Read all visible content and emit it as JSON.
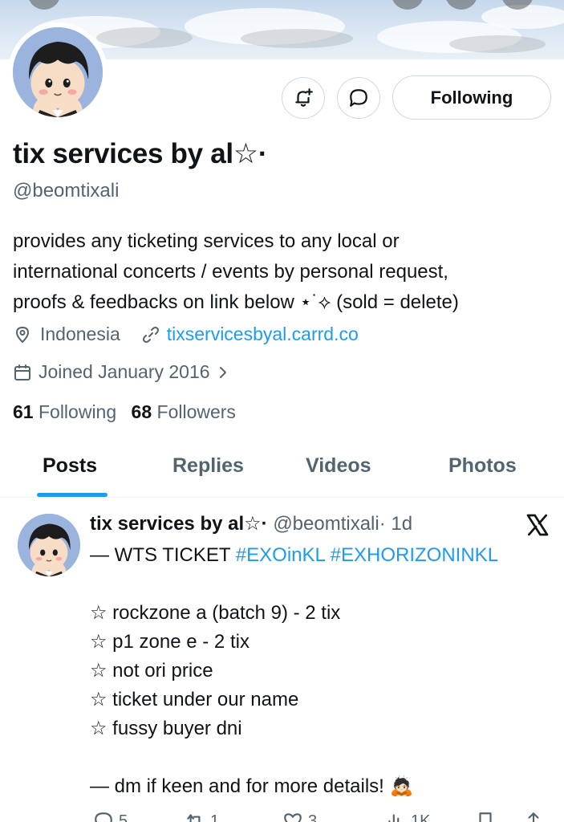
{
  "profile": {
    "display_name": "tix services by al☆·",
    "handle": "@beomtixali",
    "bio_lines": [
      "provides any ticketing services to any local or",
      "international concerts / events by personal request,",
      "proofs & feedbacks on link below ⋆˙⟡ (sold = delete)"
    ],
    "location": "Indonesia",
    "website": "tixservicesbyal.carrd.co",
    "joined": "Joined January 2016",
    "following_count": "61",
    "following_label": "Following",
    "followers_count": "68",
    "followers_label": "Followers",
    "follow_button_label": "Following"
  },
  "tabs": [
    {
      "label": "Posts",
      "active": true
    },
    {
      "label": "Replies",
      "active": false
    },
    {
      "label": "Videos",
      "active": false
    },
    {
      "label": "Photos",
      "active": false
    }
  ],
  "tweet": {
    "name": "tix services by al☆·",
    "handle": "@beomtixali",
    "time": "· 1d",
    "intro": "— WTS TICKET ",
    "hashtags": [
      "#EXOinKL",
      "#EXHORIZONINKL"
    ],
    "items": [
      "☆ rockzone a (batch 9) - 2 tix",
      "☆ p1 zone e - 2 tix",
      "☆ not ori price",
      "☆ ticket under our name",
      "☆ fussy buyer dni"
    ],
    "closing": "— dm if keen and for more details! 🙇🏻",
    "actions": {
      "replies": "5",
      "reposts": "1",
      "likes": "3",
      "views": "1K"
    }
  },
  "colors": {
    "accent": "#1d9bf0",
    "text_primary": "#0f1419",
    "text_secondary": "#536471",
    "border": "#cfd9de",
    "avatar_bg": "#9bb4de"
  },
  "icons": {
    "notify": "bell-plus-icon",
    "message": "message-bubble-icon",
    "location": "location-pin-icon",
    "link": "link-icon",
    "calendar": "calendar-icon",
    "chevron": "chevron-right-icon",
    "x_logo": "x-logo-icon"
  }
}
